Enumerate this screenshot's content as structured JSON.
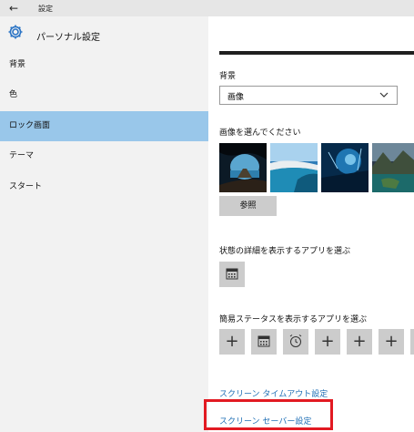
{
  "titlebar": {
    "back_icon": "back-arrow-icon",
    "title": "設定"
  },
  "header": {
    "icon": "gear-icon",
    "title": "パーソナル設定",
    "accent": "#2b74c5"
  },
  "nav": {
    "items": [
      {
        "label": "背景"
      },
      {
        "label": "色"
      },
      {
        "label": "ロック画面",
        "selected": true
      },
      {
        "label": "テーマ"
      },
      {
        "label": "スタート"
      }
    ],
    "selected_color": "#99c7ea"
  },
  "content": {
    "background_label": "背景",
    "background_select": {
      "value": "画像"
    },
    "choose_image_label": "画像を選んでください",
    "browse_button": "参照",
    "detail_status_label": "状態の詳細を表示するアプリを選ぶ",
    "quick_status_label": "簡易ステータスを表示するアプリを選ぶ",
    "quick_status_tiles": [
      "plus-icon",
      "calendar-icon",
      "alarm-clock-icon",
      "plus-icon",
      "plus-icon",
      "plus-icon",
      "plus-icon"
    ],
    "links": {
      "screen_timeout": "スクリーン タイムアウト設定",
      "screen_saver": "スクリーン セーバー設定"
    },
    "link_color": "#1f6fb5",
    "highlight_color": "#e21a22"
  }
}
